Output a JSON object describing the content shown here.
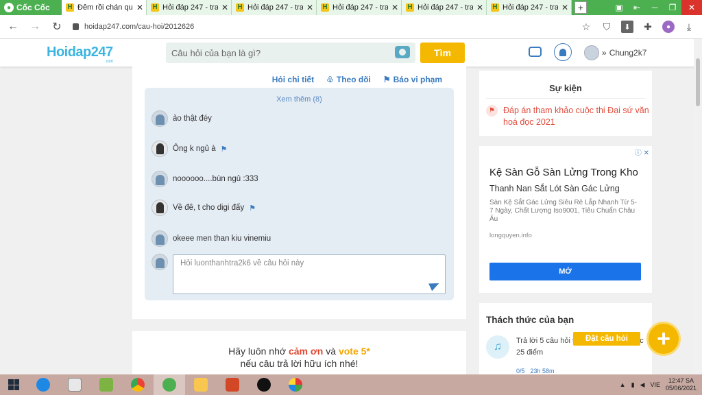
{
  "browser": {
    "name": "Cốc Cốc",
    "tabs": [
      {
        "title": "Đêm rồi chán quá",
        "active": true
      },
      {
        "title": "Hỏi đáp 247 - tra",
        "active": false
      },
      {
        "title": "Hỏi đáp 247 - tra",
        "active": false
      },
      {
        "title": "Hỏi đáp 247 - tra",
        "active": false
      },
      {
        "title": "Hỏi đáp 247 - tra",
        "active": false
      },
      {
        "title": "Hỏi đáp 247 - tra",
        "active": false
      }
    ],
    "new_tab": "+",
    "url": "hoidap247.com/cau-hoi/2012626"
  },
  "site": {
    "logo_main": "Hoidap247",
    "logo_sub": ".com",
    "search_placeholder": "Câu hỏi của bạn là gì?",
    "search_button": "Tìm",
    "username": "Chung2k7"
  },
  "question_actions": {
    "detail": "Hỏi chi tiết",
    "follow": "Theo dõi",
    "report": "Báo vi phạm"
  },
  "comments": {
    "see_more": "Xem thêm (8)",
    "items": [
      {
        "text": "ảo thật đéy",
        "avatar": "light",
        "flag": false
      },
      {
        "text": "Ông k ngủ à",
        "avatar": "dark",
        "flag": true
      },
      {
        "text": "noooooo....bùn ngủ :333",
        "avatar": "light",
        "flag": false
      },
      {
        "text": "Về đê, t cho digi đấy",
        "avatar": "dark",
        "flag": true
      },
      {
        "text": "okeee men than kiu vinemiu",
        "avatar": "light",
        "flag": false
      }
    ],
    "reply_placeholder": "Hỏi luonthanhtra2k6 về câu hỏi này"
  },
  "thanks": {
    "line1_a": "Hãy luôn nhớ ",
    "line1_b": "cảm ơn",
    "line1_c": " và ",
    "line1_d": "vote 5*",
    "line2": "nếu câu trả lời hữu ích nhé!"
  },
  "events": {
    "title": "Sự kiện",
    "item": "Đáp án tham khảo cuộc thi Đại sứ văn hoá đọc 2021"
  },
  "ad": {
    "title": "Kệ Sàn Gỗ Sàn Lửng Trong Kho",
    "subtitle": "Thanh Nan Sắt Lót Sàn Gác Lửng",
    "description": "Sàn Kệ Sắt Gác Lửng Siêu Rẻ Lắp Nhanh Từ 5-7 Ngày, Chất Lượng Iso9001, Tiêu Chuẩn Châu Âu",
    "url": "longquyen.info",
    "button": "MỞ"
  },
  "challenge": {
    "title": "Thách thức của bạn",
    "text": "Trả lời 5 câu hỏi trong 24 giờ để được 25 điểm",
    "progress": "0/5",
    "time": "23h  58m"
  },
  "ask": {
    "label": "Đặt câu hỏi",
    "plus": "+"
  },
  "taskbar": {
    "lang": "VIE",
    "time": "12:47 SA",
    "date": "05/06/2021"
  },
  "colors": {
    "brand_green": "#4caf50",
    "accent_blue": "#3a7bbf",
    "gold": "#f5b800",
    "red": "#e04a3a"
  }
}
